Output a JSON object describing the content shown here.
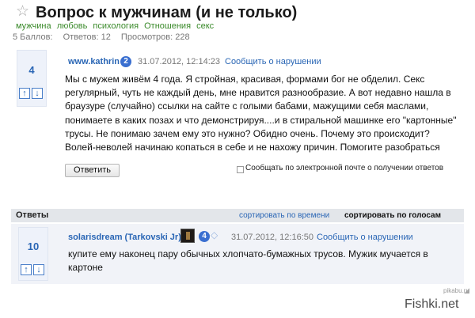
{
  "question": {
    "star_icon": "☆",
    "title": "Вопрос к мужчинам (и не только)",
    "tags": [
      "мужчина",
      "любовь",
      "психология",
      "Отношения",
      "секс"
    ],
    "stats": {
      "points": "5 Баллов:",
      "answers": "Ответов: 12",
      "views": "Просмотров: 228"
    },
    "votes": "4",
    "author": "www.kathrin",
    "author_level": "2",
    "date": "31.07.2012, 12:14:23",
    "report_label": "Сообщить о нарушении",
    "body_lines": [
      "Мы с мужем живём 4 года. Я стройная, красивая, формами бог не обделил. Секс",
      "регулярный, чуть не каждый день, мне нравится разнообразие. А вот недавно нашла в",
      "браузуре (случайно) ссылки на сайте с голыми бабами, мажущими себя маслами,",
      "понимаете в каких позах и что демонстрируя....и в стиральной машинке его \"картонные\"",
      "трусы. Не понимаю зачем ему это нужно? Обидно очень. Почему это происходит?",
      "Волей-неволей начинаю копаться в себе и не нахожу причин. Помогите разобраться"
    ],
    "reply_label": "Ответить",
    "notify_label": "Сообщать по электронной почте о получении ответов"
  },
  "answers_header": {
    "label": "Ответы",
    "sort_time": "сортировать по времени",
    "sort_votes": "сортировать по голосам"
  },
  "answer": {
    "votes": "10",
    "author": "solarisdream (Tarkovski Jr)",
    "author_level": "4",
    "date": "31.07.2012, 12:16:50",
    "report_label": "Сообщить о нарушении",
    "body_lines": [
      "купите ему наконец пару обычных хлопчато-бумажных трусов. Мужик мучается в",
      "картоне"
    ]
  },
  "arrows": {
    "up": "↑",
    "down": "↓"
  },
  "watermark": {
    "small": "pikabu.ru",
    "brand": "Fishki.net"
  }
}
